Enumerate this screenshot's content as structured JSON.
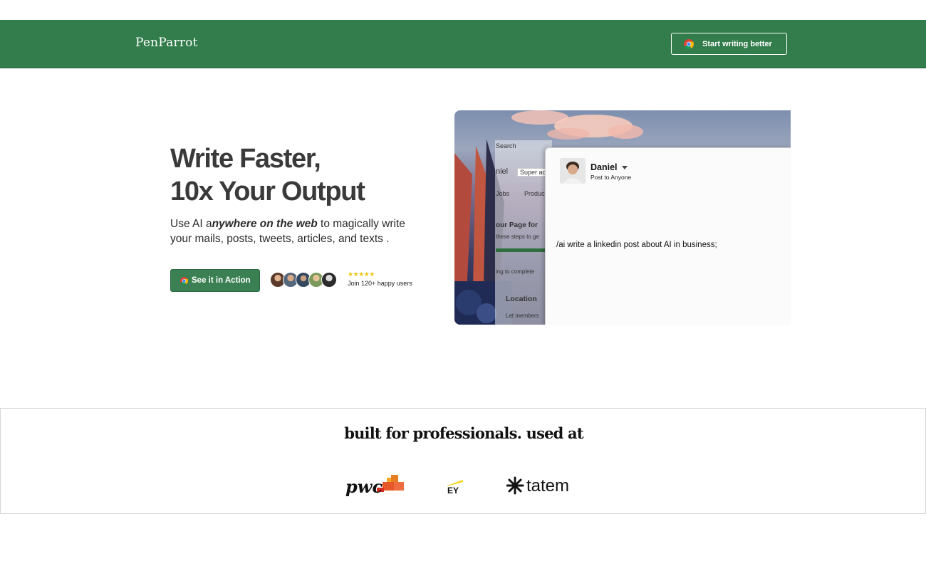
{
  "header": {
    "brand": "PenParrot",
    "cta_label": "Start writing better",
    "bg_color": "#327d4b"
  },
  "hero": {
    "title_line1": "Write Faster,",
    "title_line2": "10x Your Output",
    "subtitle_pre": "Use AI a",
    "subtitle_em": "nywhere on the web",
    "subtitle_post": " to magically write your mails, posts, tweets, articles, and texts .",
    "cta_label": "See it in Action",
    "stars": "★★★★★",
    "social_proof": "Join 120+ happy users"
  },
  "screenshot": {
    "bg_labels": [
      "Search",
      "niel",
      "Super ad",
      "Jobs",
      "Produc",
      "our Page for",
      "these steps to ge",
      "ing to complete",
      "Location",
      "Let members"
    ],
    "post_author": "Daniel",
    "post_audience": "Post to Anyone",
    "post_text": "/ai write a linkedin post about AI in business;"
  },
  "professionals": {
    "title": "built for professionals. used at",
    "logos": [
      "pwc",
      "EY",
      "tatem"
    ]
  }
}
